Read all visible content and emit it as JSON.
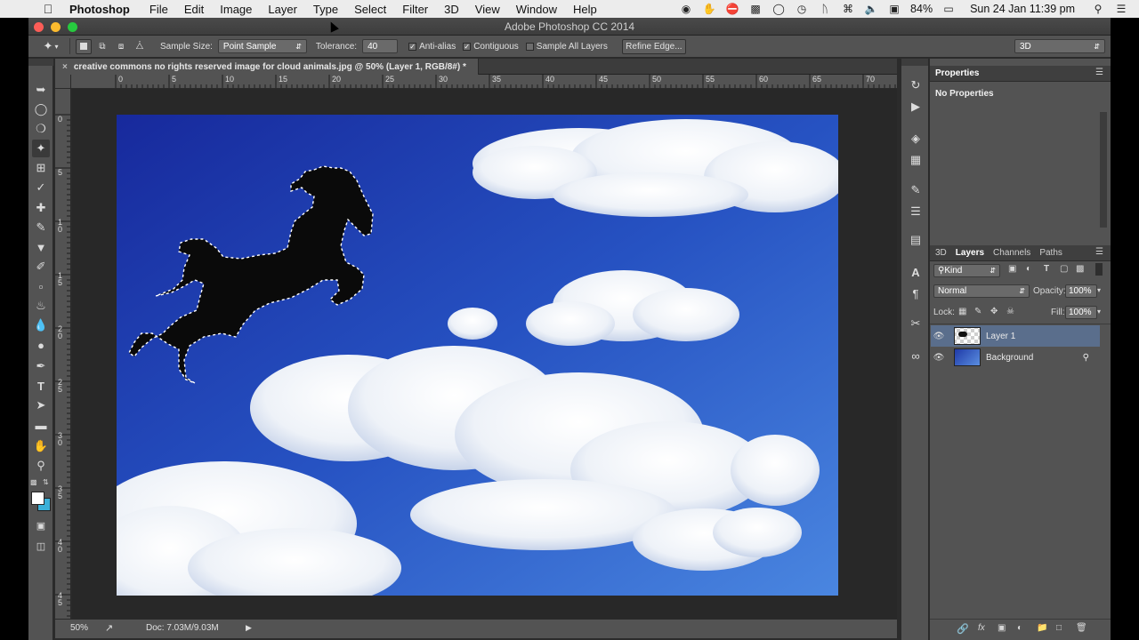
{
  "menubar": {
    "app_name": "Photoshop",
    "items": [
      "File",
      "Edit",
      "Image",
      "Layer",
      "Type",
      "Select",
      "Filter",
      "3D",
      "View",
      "Window",
      "Help"
    ],
    "battery": "84%",
    "datetime": "Sun 24 Jan  11:39 pm"
  },
  "titlebar": {
    "title": "Adobe Photoshop CC 2014"
  },
  "options": {
    "sample_size_label": "Sample Size:",
    "sample_size_value": "Point Sample",
    "tolerance_label": "Tolerance:",
    "tolerance_value": "40",
    "antialias_label": "Anti-alias",
    "contiguous_label": "Contiguous",
    "sample_all_label": "Sample All Layers",
    "refine_edge_label": "Refine Edge...",
    "workspace_value": "3D"
  },
  "document": {
    "tab_title": "creative commons no rights reserved image for cloud animals.jpg @ 50% (Layer 1, RGB/8#) *"
  },
  "ruler": {
    "top_labels": [
      "0",
      "5",
      "10",
      "15",
      "20",
      "25",
      "30",
      "35",
      "40",
      "45",
      "50",
      "55",
      "60",
      "65",
      "70"
    ],
    "left_labels": [
      "0",
      "5",
      "1 0",
      "1 5",
      "2 0",
      "2 5",
      "3 0",
      "3 5",
      "4 0",
      "4 5"
    ]
  },
  "status": {
    "zoom": "50%",
    "doc_size": "Doc: 7.03M/9.03M"
  },
  "properties": {
    "tab_label": "Properties",
    "empty_text": "No Properties"
  },
  "layers_panel": {
    "tabs": [
      "3D",
      "Layers",
      "Channels",
      "Paths"
    ],
    "filter_value": "Kind",
    "blend_mode": "Normal",
    "opacity_label": "Opacity:",
    "opacity_value": "100%",
    "lock_label": "Lock:",
    "fill_label": "Fill:",
    "fill_value": "100%",
    "layers": [
      {
        "name": "Layer 1",
        "selected": true
      },
      {
        "name": "Background",
        "selected": false
      }
    ]
  },
  "colors": {
    "accent_selected_layer": "#5a6e8c",
    "sky_top": "#1d34a8",
    "sky_bottom": "#3f78d8"
  }
}
